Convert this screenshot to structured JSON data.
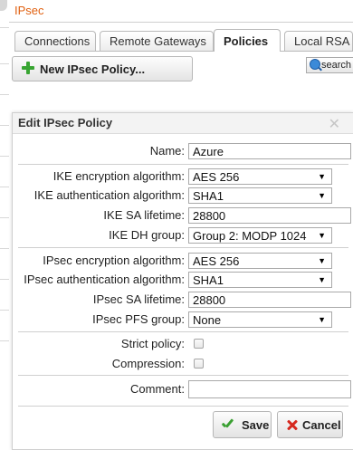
{
  "window": {
    "title": "IPsec"
  },
  "tabs": [
    {
      "label": "Connections"
    },
    {
      "label": "Remote Gateways"
    },
    {
      "label": "Policies",
      "active": true
    },
    {
      "label": "Local RSA Ke"
    }
  ],
  "toolbar": {
    "new_policy_label": "New IPsec Policy...",
    "search_label": "search"
  },
  "dialog": {
    "title": "Edit IPsec Policy",
    "fields": {
      "name": {
        "label": "Name:",
        "value": "Azure"
      },
      "ike_encryption": {
        "label": "IKE encryption algorithm:",
        "value": "AES 256"
      },
      "ike_authentication": {
        "label": "IKE authentication algorithm:",
        "value": "SHA1"
      },
      "ike_sa_lifetime": {
        "label": "IKE SA lifetime:",
        "value": "28800"
      },
      "ike_dh_group": {
        "label": "IKE DH group:",
        "value": "Group 2: MODP 1024"
      },
      "ipsec_encryption": {
        "label": "IPsec encryption algorithm:",
        "value": "AES 256"
      },
      "ipsec_authentication": {
        "label": "IPsec authentication algorithm:",
        "value": "SHA1"
      },
      "ipsec_sa_lifetime": {
        "label": "IPsec SA lifetime:",
        "value": "28800"
      },
      "ipsec_pfs_group": {
        "label": "IPsec PFS group:",
        "value": "None"
      },
      "strict_policy": {
        "label": "Strict policy:",
        "checked": false
      },
      "compression": {
        "label": "Compression:",
        "checked": false
      },
      "comment": {
        "label": "Comment:",
        "value": ""
      }
    },
    "save_label": "Save",
    "cancel_label": "Cancel"
  },
  "colors": {
    "title_accent": "#e06010",
    "save_icon": "#3aa032",
    "cancel_icon": "#d6281e",
    "add_icon": "#38a532"
  },
  "icons": {
    "close": "close-icon",
    "add": "plus-icon",
    "search": "search-icon",
    "save": "check-icon",
    "cancel": "x-icon"
  }
}
